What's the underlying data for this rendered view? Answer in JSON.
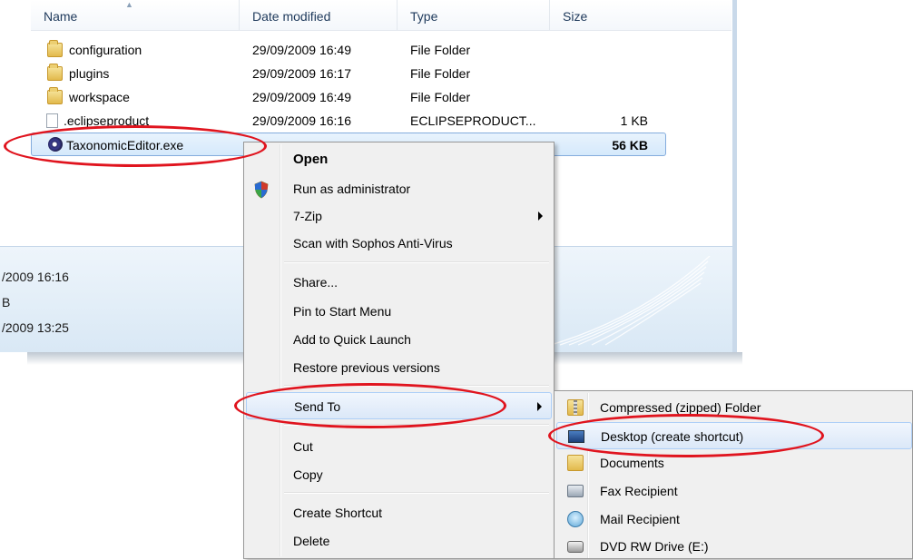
{
  "columns": {
    "name": "Name",
    "date": "Date modified",
    "type": "Type",
    "size": "Size"
  },
  "files": [
    {
      "name": "configuration",
      "date": "29/09/2009 16:49",
      "type": "File Folder",
      "size": "",
      "icon": "folder-icon"
    },
    {
      "name": "plugins",
      "date": "29/09/2009 16:17",
      "type": "File Folder",
      "size": "",
      "icon": "folder-icon"
    },
    {
      "name": "workspace",
      "date": "29/09/2009 16:49",
      "type": "File Folder",
      "size": "",
      "icon": "folder-icon"
    },
    {
      "name": ".eclipseproduct",
      "date": "29/09/2009 16:16",
      "type": "ECLIPSEPRODUCT...",
      "size": "1 KB",
      "icon": "document-icon"
    },
    {
      "name": "TaxonomicEditor.exe",
      "date": "",
      "type": "",
      "size": "56 KB",
      "icon": "eclipse-exe-icon"
    }
  ],
  "details": {
    "line1": "/2009 16:16",
    "line2": "B",
    "line3": "/2009 13:25"
  },
  "context_menu": {
    "open": "Open",
    "run_as_admin": "Run as administrator",
    "seven_zip": "7-Zip",
    "scan": "Scan with Sophos Anti-Virus",
    "share": "Share...",
    "pin_start": "Pin to Start Menu",
    "quick_launch": "Add to Quick Launch",
    "restore": "Restore previous versions",
    "send_to": "Send To",
    "cut": "Cut",
    "copy": "Copy",
    "create_shortcut": "Create Shortcut",
    "delete": "Delete"
  },
  "send_to_menu": [
    {
      "label": "Compressed (zipped) Folder",
      "icon": "zip-folder-icon"
    },
    {
      "label": "Desktop (create shortcut)",
      "icon": "desktop-icon"
    },
    {
      "label": "Documents",
      "icon": "documents-icon"
    },
    {
      "label": "Fax Recipient",
      "icon": "fax-icon"
    },
    {
      "label": "Mail Recipient",
      "icon": "mail-icon"
    },
    {
      "label": "DVD RW Drive (E:)",
      "icon": "dvd-drive-icon"
    }
  ],
  "colors": {
    "annotation": "#e0141e",
    "highlight_border": "#aecff7",
    "selection_border": "#84acdd",
    "menu_background": "#f0f0f0"
  }
}
